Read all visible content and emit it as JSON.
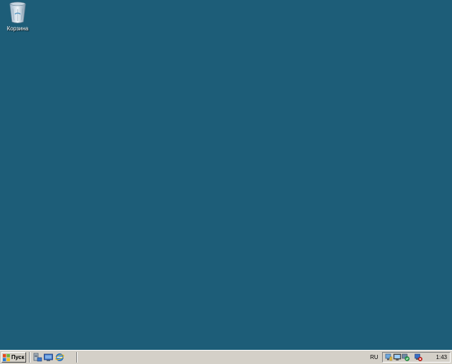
{
  "desktop": {
    "background_color": "#1d5d78",
    "icons": [
      {
        "label": "Корзина",
        "icon": "recycle-bin-icon"
      }
    ]
  },
  "taskbar": {
    "start_label": "Пуск",
    "quick_launch": [
      "server-manager-icon",
      "show-desktop-icon",
      "internet-explorer-icon"
    ],
    "language": "RU",
    "tray_icons": [
      "network-icon",
      "monitor-icon",
      "security-shield-icon",
      "network-alert-icon"
    ],
    "clock": "1:43"
  }
}
